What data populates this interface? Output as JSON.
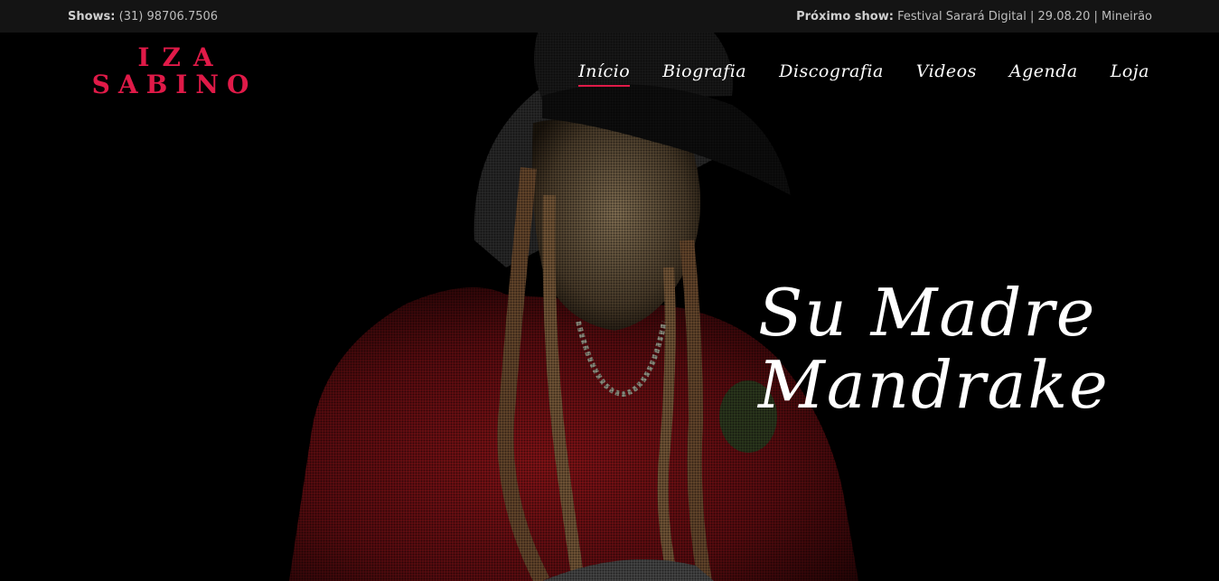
{
  "topbar": {
    "shows_label": "Shows:",
    "shows_phone": "(31) 98706.7506",
    "next_show_label": "Próximo show:",
    "next_show_value": "Festival Sarará Digital | 29.08.20 | Mineirão"
  },
  "logo": {
    "line1": "IZA",
    "line2": "SABINO",
    "color": "#e01a48"
  },
  "nav": {
    "items": [
      {
        "label": "Início",
        "active": true
      },
      {
        "label": "Biografia",
        "active": false
      },
      {
        "label": "Discografia",
        "active": false
      },
      {
        "label": "Videos",
        "active": false
      },
      {
        "label": "Agenda",
        "active": false
      },
      {
        "label": "Loja",
        "active": false
      }
    ]
  },
  "hero": {
    "headline_line1": "Su Madre",
    "headline_line2": "Mandrake"
  }
}
